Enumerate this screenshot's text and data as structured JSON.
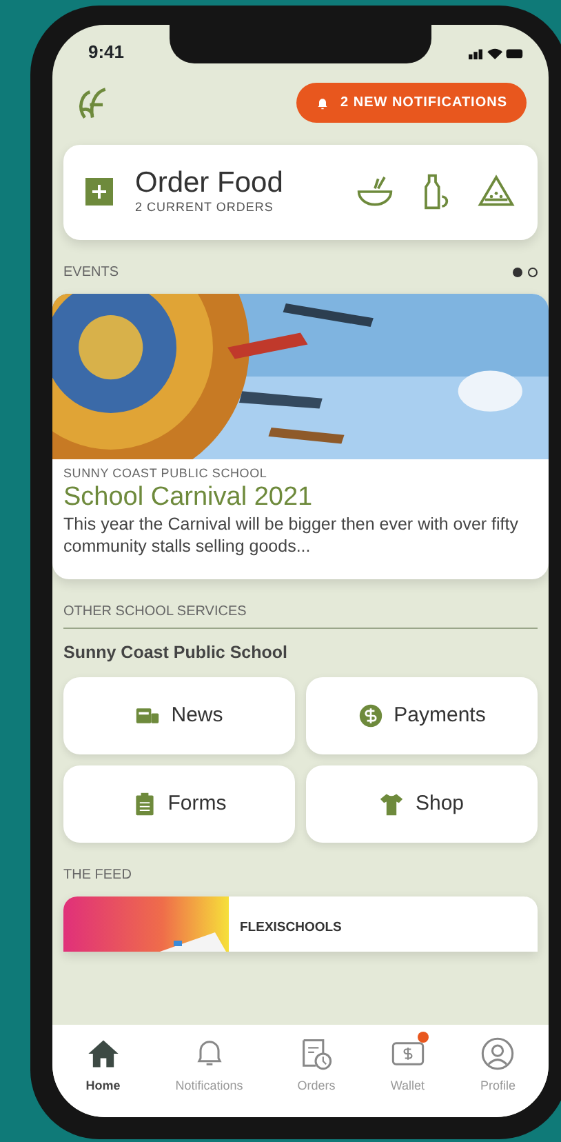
{
  "status_bar": {
    "time": "9:41"
  },
  "header": {
    "notifications_button": "2 NEW NOTIFICATIONS"
  },
  "order_card": {
    "title": "Order Food",
    "subtitle": "2 CURRENT ORDERS"
  },
  "events": {
    "heading": "EVENTS",
    "pages": [
      {
        "selected": true
      },
      {
        "selected": false
      }
    ],
    "card": {
      "school": "SUNNY COAST PUBLIC SCHOOL",
      "title": "School Carnival 2021",
      "text": "This year the Carnival will be bigger then ever with over fifty community stalls selling goods..."
    }
  },
  "services": {
    "heading": "OTHER SCHOOL SERVICES",
    "school": "Sunny Coast Public School",
    "buttons": [
      {
        "kind": "news",
        "label": "News"
      },
      {
        "kind": "payments",
        "label": "Payments"
      },
      {
        "kind": "forms",
        "label": "Forms"
      },
      {
        "kind": "shop",
        "label": "Shop"
      }
    ]
  },
  "feed": {
    "heading": "THE FEED",
    "card": {
      "source": "FLEXISCHOOLS"
    }
  },
  "tab_bar": [
    {
      "kind": "home",
      "label": "Home",
      "selected": true,
      "badge": false
    },
    {
      "kind": "bell",
      "label": "Notifications",
      "selected": false,
      "badge": false
    },
    {
      "kind": "orders",
      "label": "Orders",
      "selected": false,
      "badge": false
    },
    {
      "kind": "wallet",
      "label": "Wallet",
      "selected": false,
      "badge": true
    },
    {
      "kind": "profile",
      "label": "Profile",
      "selected": false,
      "badge": false
    }
  ]
}
